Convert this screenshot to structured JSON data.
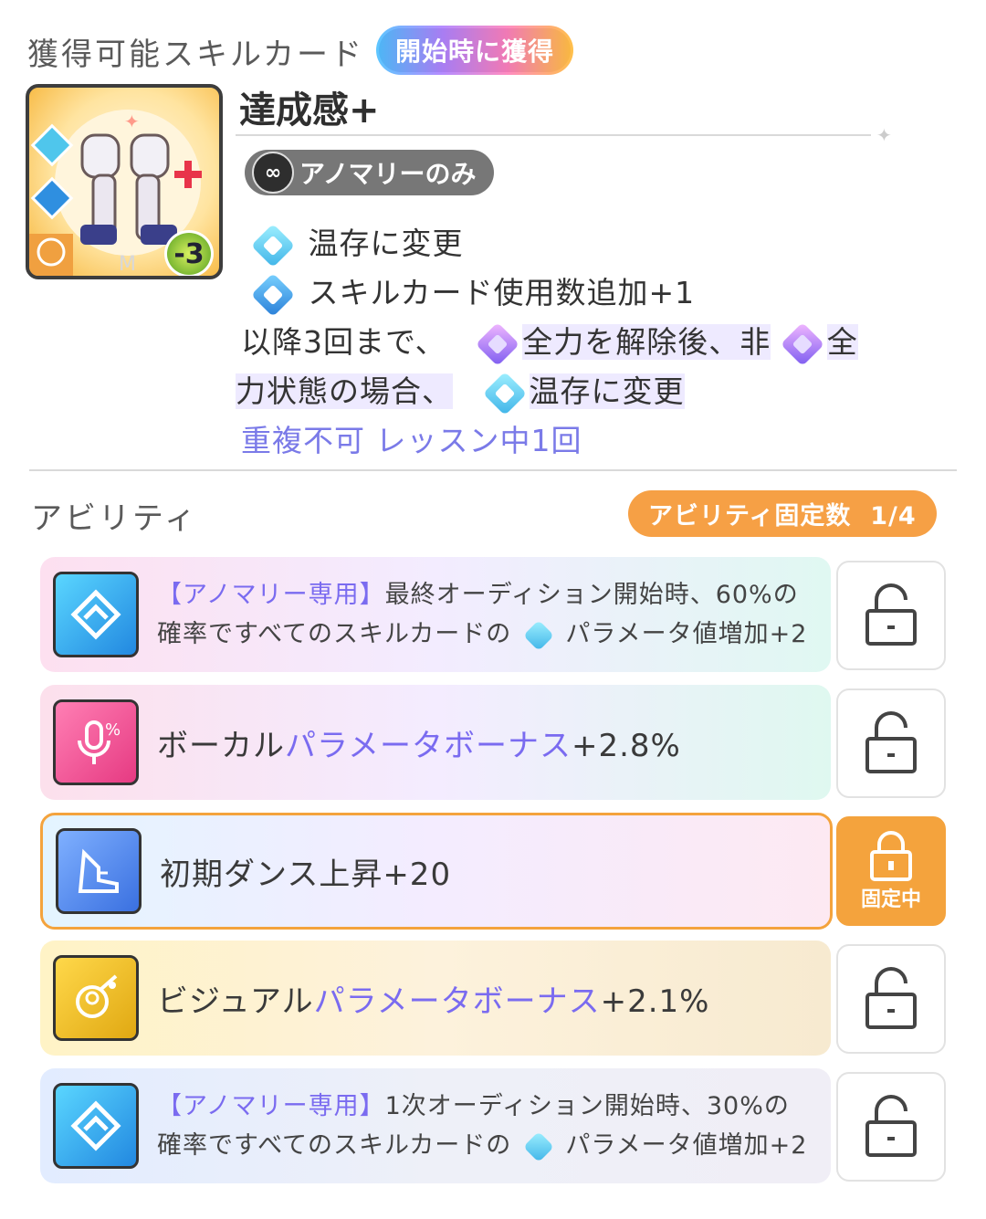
{
  "header": {
    "title": "獲得可能スキルカード",
    "timing_badge": "開始時に獲得"
  },
  "card": {
    "name": "達成感+",
    "cost": "-3",
    "tag": "アノマリーのみ",
    "effects": [
      {
        "icon": "retain-icon",
        "text": "温存に変更"
      },
      {
        "icon": "skill-card-plus-icon",
        "text": "スキルカード使用数追加+1"
      }
    ],
    "cond_part1": "以降3回まで、",
    "cond_full_power": "全力を解除後、非",
    "cond_full_power2a": "全",
    "cond_full_power2b": "力状態の場合、",
    "cond_retain": "温存に変更",
    "note_no_dup": "重複不可",
    "note_lesson": "レッスン中1回"
  },
  "abilities_section": {
    "title": "アビリティ",
    "fixed_label": "アビリティ固定数",
    "fixed_count": "1/4",
    "locked_label": "固定中"
  },
  "abilities": [
    {
      "tag": "【アノマリー専用】",
      "line1": "最終オーディション開始時、60%の",
      "line2a": "確率ですべてのスキルカードの",
      "line2b": "パラメータ値増加+2",
      "icon": "skill-boost-icon"
    },
    {
      "prefix": "ボーカル",
      "highlight": "パラメータボーナス",
      "suffix": "+2.8%",
      "icon": "vocal-mic-icon"
    },
    {
      "text": "初期ダンス上昇+20",
      "icon": "dance-shoe-icon"
    },
    {
      "prefix": "ビジュアル",
      "highlight": "パラメータボーナス",
      "suffix": "+2.1%",
      "icon": "visual-icon"
    },
    {
      "tag": "【アノマリー専用】",
      "line1": "1次オーディション開始時、30%の",
      "line2a": "確率ですべてのスキルカードの",
      "line2b": "パラメータ値増加+2",
      "icon": "skill-boost-icon"
    }
  ],
  "colors": {
    "accent_orange": "#f6a045",
    "accent_purple": "#7a6bf0",
    "vocal_pink": "#ef4d8a",
    "dance_blue": "#4a8ee8",
    "visual_gold": "#e6b62a"
  }
}
